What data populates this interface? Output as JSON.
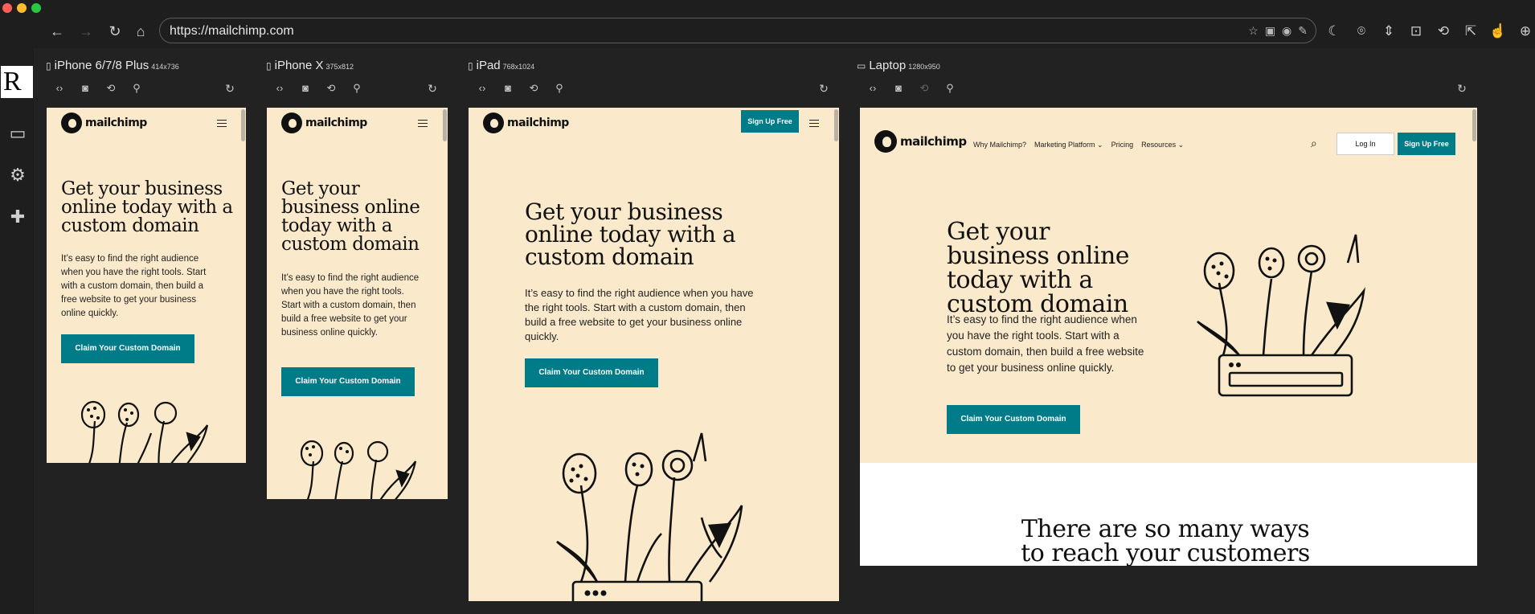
{
  "window": {
    "traffic_colors": {
      "close": "#ff5f57",
      "minimize": "#febc2e",
      "zoom": "#28c840"
    }
  },
  "browser": {
    "url": "https://mailchimp.com"
  },
  "devices": [
    {
      "name": "iPhone 6/7/8 Plus",
      "dims": "414x736"
    },
    {
      "name": "iPhone X",
      "dims": "375x812"
    },
    {
      "name": "iPad",
      "dims": "768x1024"
    },
    {
      "name": "Laptop",
      "dims": "1280x950"
    }
  ],
  "site": {
    "brand": "mailchimp",
    "headline": "Get your business online today with a custom domain",
    "body": "It’s easy to find the right audience when you have the right tools. Start with a custom domain, then build a free website to get your business online quickly.",
    "cta": "Claim Your Custom Domain",
    "signup": "Sign Up Free",
    "login": "Log In",
    "nav": [
      "Why Mailchimp?",
      "Marketing Platform ⌄",
      "Pricing",
      "Resources ⌄"
    ],
    "section_heading": "There are so many ways to reach your customers"
  },
  "colors": {
    "cream": "#faeacb",
    "teal": "#007c89"
  }
}
